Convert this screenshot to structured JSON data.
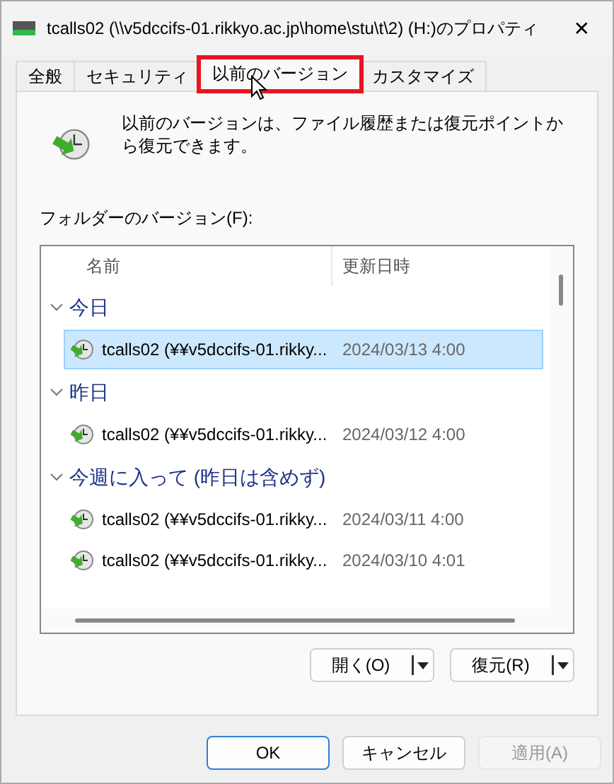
{
  "window": {
    "title": "tcalls02 (\\\\v5dccifs-01.rikkyo.ac.jp\\home\\stu\\t\\2) (H:)のプロパティ",
    "close": "✕"
  },
  "tabs": [
    {
      "label": "全般",
      "selected": false,
      "highlighted": false
    },
    {
      "label": "セキュリティ",
      "selected": false,
      "highlighted": false
    },
    {
      "label": "以前のバージョン",
      "selected": true,
      "highlighted": true
    },
    {
      "label": "カスタマイズ",
      "selected": false,
      "highlighted": false
    }
  ],
  "description": "以前のバージョンは、ファイル履歴または復元ポイントから復元できます。",
  "list_label": "フォルダーのバージョン(F):",
  "columns": [
    "名前",
    "更新日時"
  ],
  "groups": [
    {
      "label": "今日",
      "expanded": true,
      "items": [
        {
          "name": "tcalls02 (¥¥v5dccifs-01.rikky...",
          "date": "2024/03/13 4:00",
          "selected": true
        }
      ]
    },
    {
      "label": "昨日",
      "expanded": true,
      "items": [
        {
          "name": "tcalls02 (¥¥v5dccifs-01.rikky...",
          "date": "2024/03/12 4:00",
          "selected": false
        }
      ]
    },
    {
      "label": "今週に入って (昨日は含めず)",
      "expanded": true,
      "items": [
        {
          "name": "tcalls02 (¥¥v5dccifs-01.rikky...",
          "date": "2024/03/11 4:00",
          "selected": false
        },
        {
          "name": "tcalls02 (¥¥v5dccifs-01.rikky...",
          "date": "2024/03/10 4:01",
          "selected": false
        }
      ]
    }
  ],
  "split_buttons": [
    {
      "label": "開く(O)"
    },
    {
      "label": "復元(R)"
    }
  ],
  "dialog_buttons": [
    {
      "label": "OK",
      "default": true,
      "disabled": false
    },
    {
      "label": "キャンセル",
      "default": false,
      "disabled": false
    },
    {
      "label": "適用(A)",
      "default": false,
      "disabled": true
    }
  ]
}
